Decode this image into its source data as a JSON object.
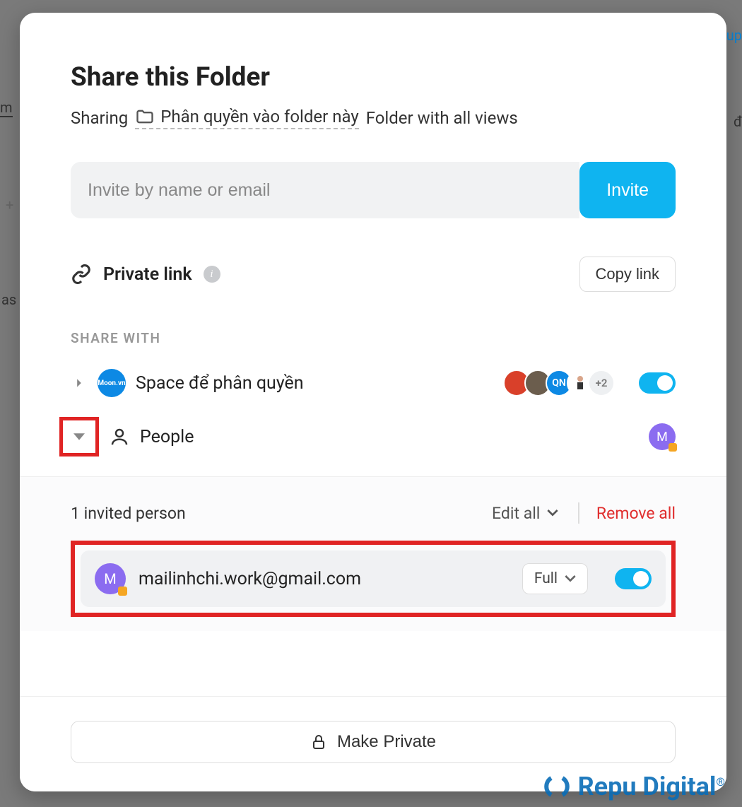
{
  "header": {
    "title": "Share this Folder",
    "sharing_label": "Sharing",
    "folder_name": "Phân quyền vào folder này",
    "sharing_suffix": "Folder with all views"
  },
  "invite": {
    "placeholder": "Invite by name or email",
    "button_label": "Invite"
  },
  "private_link": {
    "label": "Private link",
    "copy_button": "Copy link"
  },
  "share_with": {
    "heading": "SHARE WITH",
    "space": {
      "avatar_text": "Moon.vn",
      "label": "Space để phân quyền",
      "members": [
        {
          "color": "#d9402a",
          "initials": ""
        },
        {
          "color": "#6b5d4d",
          "initials": ""
        },
        {
          "color": "#0d89e4",
          "initials": "QN"
        },
        {
          "color": "#ffffff",
          "initials": ""
        }
      ],
      "more_count": "+2",
      "toggle_on": true
    },
    "people": {
      "label": "People",
      "avatar_initial": "M"
    }
  },
  "invited": {
    "count_label": "1 invited person",
    "edit_all_label": "Edit all",
    "remove_all_label": "Remove all",
    "members": [
      {
        "initial": "M",
        "email": "mailinhchi.work@gmail.com",
        "permission": "Full",
        "toggle_on": true
      }
    ]
  },
  "footer": {
    "make_private_label": "Make Private"
  },
  "watermark": "Repu Digital",
  "backdrop": {
    "top_right": "up",
    "left_m": "m",
    "right_d": "đ",
    "plus": "+",
    "as": "as"
  }
}
